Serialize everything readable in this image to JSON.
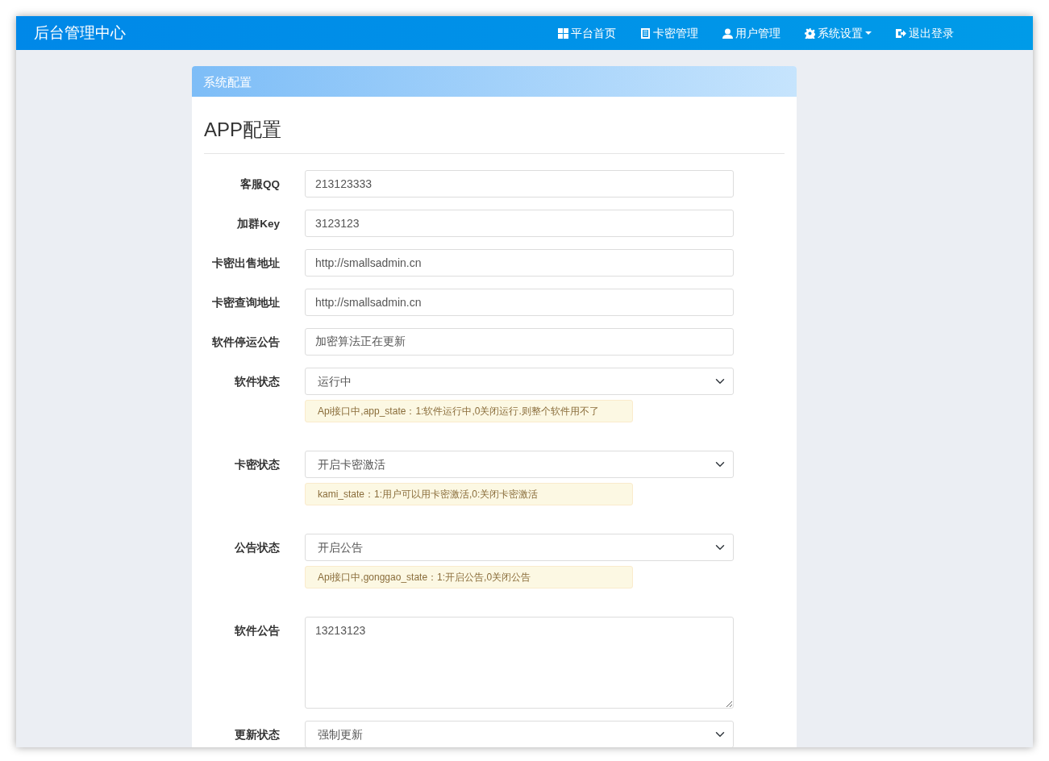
{
  "brand": "后台管理中心",
  "nav": [
    {
      "label": "平台首页",
      "kind": "grid",
      "dropdown": false
    },
    {
      "label": "卡密管理",
      "kind": "list",
      "dropdown": false
    },
    {
      "label": "用户管理",
      "kind": "user",
      "dropdown": false
    },
    {
      "label": "系统设置",
      "kind": "gear",
      "dropdown": true
    },
    {
      "label": "退出登录",
      "kind": "logout",
      "dropdown": false
    }
  ],
  "panel": {
    "title": "系统配置",
    "heading": "APP配置",
    "fields": [
      {
        "kind": "text",
        "label": "客服QQ",
        "value": "213123333"
      },
      {
        "kind": "text",
        "label": "加群Key",
        "value": "3123123"
      },
      {
        "kind": "text",
        "label": "卡密出售地址",
        "value": "http://smallsadmin.cn"
      },
      {
        "kind": "text",
        "label": "卡密查询地址",
        "value": "http://smallsadmin.cn"
      },
      {
        "kind": "text",
        "label": "软件停运公告",
        "value": "加密算法正在更新"
      },
      {
        "kind": "select",
        "label": "软件状态",
        "value": "运行中",
        "hint": "Api接口中,app_state：1:软件运行中,0关闭运行.则整个软件用不了"
      },
      {
        "kind": "select",
        "label": "卡密状态",
        "value": "开启卡密激活",
        "hint": "kami_state：1:用户可以用卡密激活,0:关闭卡密激活"
      },
      {
        "kind": "select",
        "label": "公告状态",
        "value": "开启公告",
        "hint": "Api接口中,gonggao_state：1:开启公告,0关闭公告"
      },
      {
        "kind": "textarea",
        "label": "软件公告",
        "value": "13213123"
      },
      {
        "kind": "select",
        "label": "更新状态",
        "value": "强制更新"
      }
    ]
  }
}
